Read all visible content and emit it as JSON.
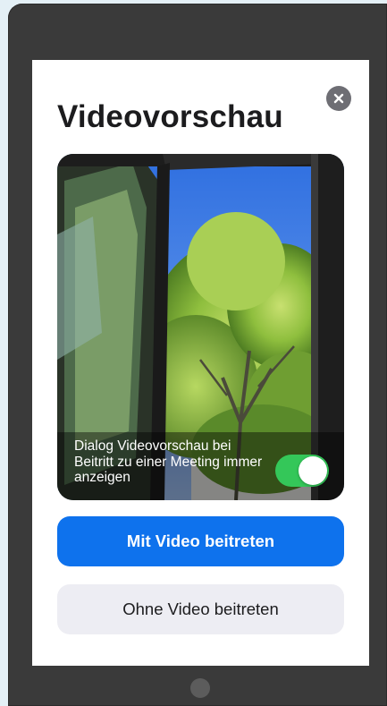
{
  "dialog": {
    "title": "Videovorschau",
    "close_icon": "close-icon"
  },
  "preview": {
    "label": "Dialog Videovorschau bei Beitritt zu einer Meeting immer anzeigen",
    "toggle_on": true
  },
  "buttons": {
    "with_video": "Mit Video beitreten",
    "without_video": "Ohne Video beitreten"
  },
  "colors": {
    "primary": "#0e72ed",
    "toggle_on": "#34c759",
    "secondary_bg": "#ededf3",
    "device_frame": "#3a3a3a"
  }
}
